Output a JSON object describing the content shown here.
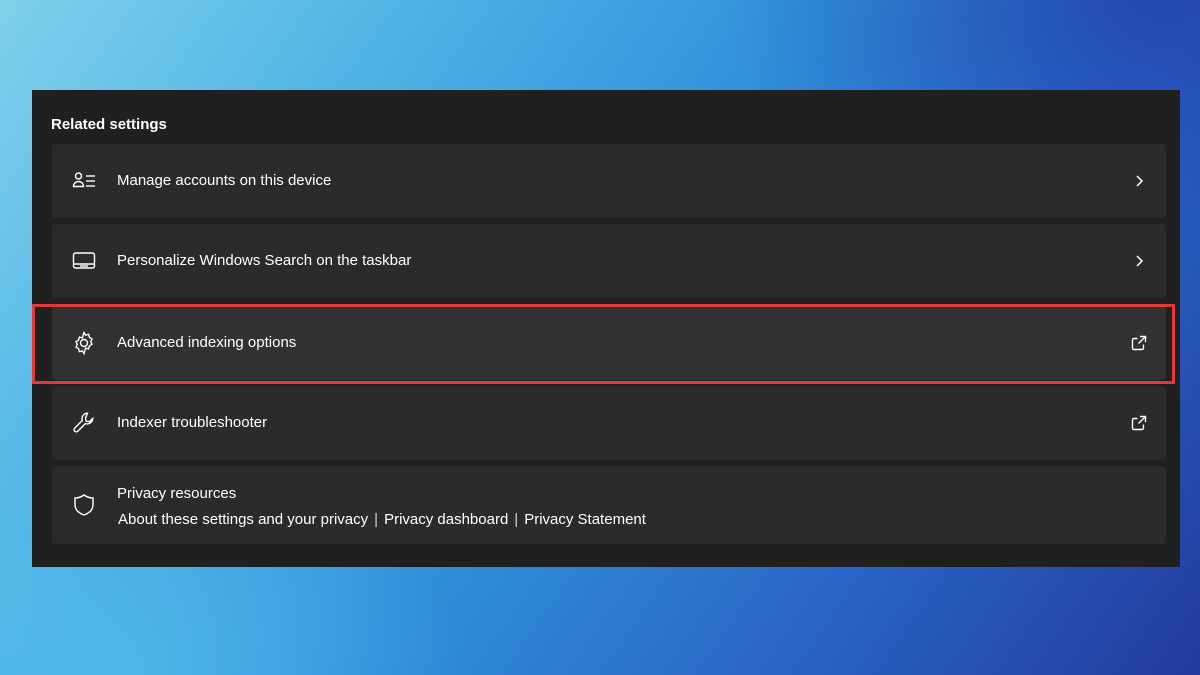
{
  "section": {
    "title": "Related settings"
  },
  "items": [
    {
      "label": "Manage accounts on this device",
      "icon": "person-list-icon",
      "trail": "chevron-right-icon"
    },
    {
      "label": "Personalize Windows Search on the taskbar",
      "icon": "taskbar-icon",
      "trail": "chevron-right-icon"
    },
    {
      "label": "Advanced indexing options",
      "icon": "gear-icon",
      "trail": "external-link-icon",
      "highlighted": true
    },
    {
      "label": "Indexer troubleshooter",
      "icon": "wrench-icon",
      "trail": "external-link-icon"
    }
  ],
  "privacy": {
    "title": "Privacy resources",
    "icon": "shield-icon",
    "links": [
      "About these settings and your privacy",
      "Privacy dashboard",
      "Privacy Statement"
    ],
    "separator": "|"
  },
  "colors": {
    "panel_bg": "#202020",
    "card_bg": "#2b2b2b",
    "highlight_border": "#e03a3a",
    "text": "#ffffff"
  }
}
